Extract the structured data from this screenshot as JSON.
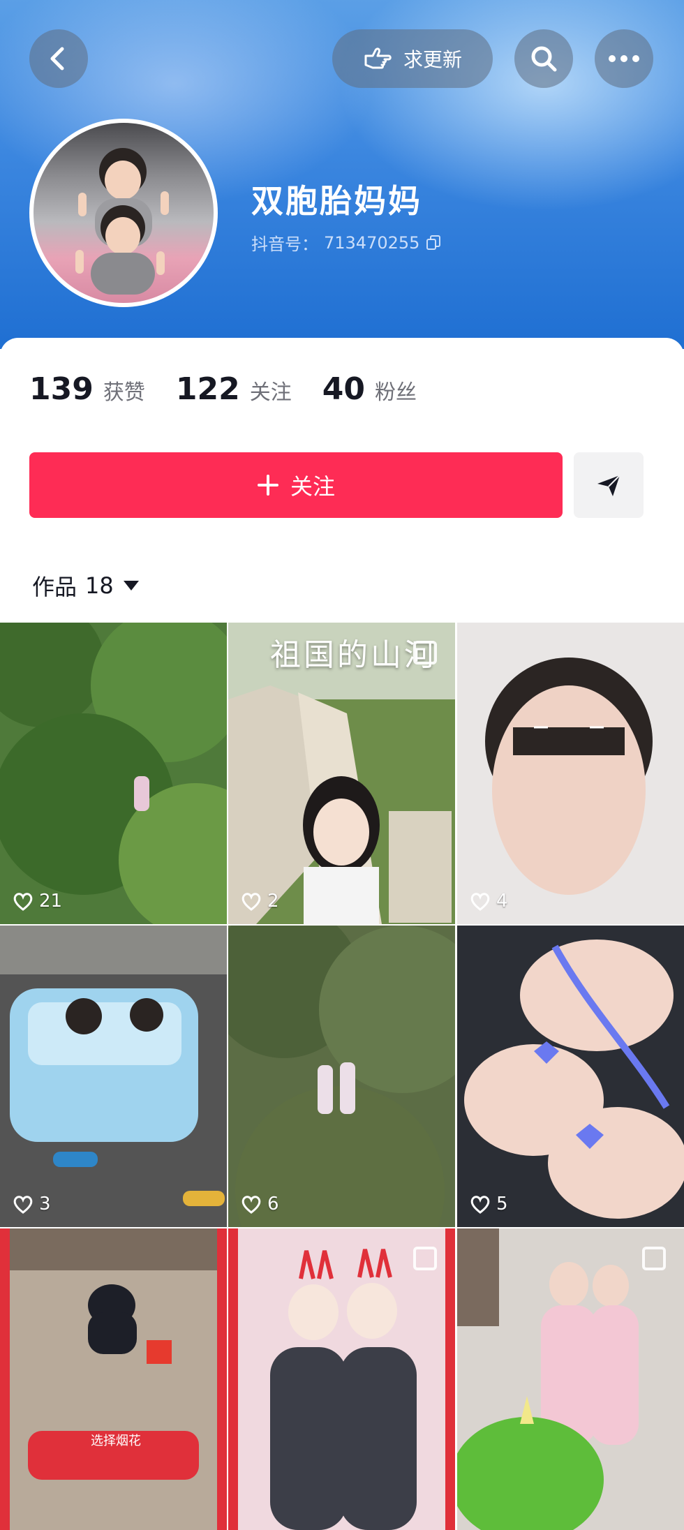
{
  "header": {
    "back_icon": "chevron-left-icon",
    "request_update_label": "求更新",
    "search_icon": "search-icon",
    "more_icon": "more-icon"
  },
  "profile": {
    "name": "双胞胎妈妈",
    "handle_label": "抖音号：",
    "handle_value": "713470255"
  },
  "stats": [
    {
      "value": "139",
      "label": "获赞"
    },
    {
      "value": "122",
      "label": "关注"
    },
    {
      "value": "40",
      "label": "粉丝"
    }
  ],
  "actions": {
    "follow_label": "关注",
    "follow_color": "#fe2c55"
  },
  "works": {
    "label": "作品",
    "count": "18"
  },
  "grid": [
    {
      "likes": "21"
    },
    {
      "likes": "2",
      "overlay_text": "祖国的山河"
    },
    {
      "likes": "4"
    },
    {
      "likes": "3"
    },
    {
      "likes": "6"
    },
    {
      "likes": "5"
    },
    {
      "bottom_banner": "选择烟花"
    },
    {
      "pinned": true
    },
    {
      "pinned": true
    }
  ]
}
